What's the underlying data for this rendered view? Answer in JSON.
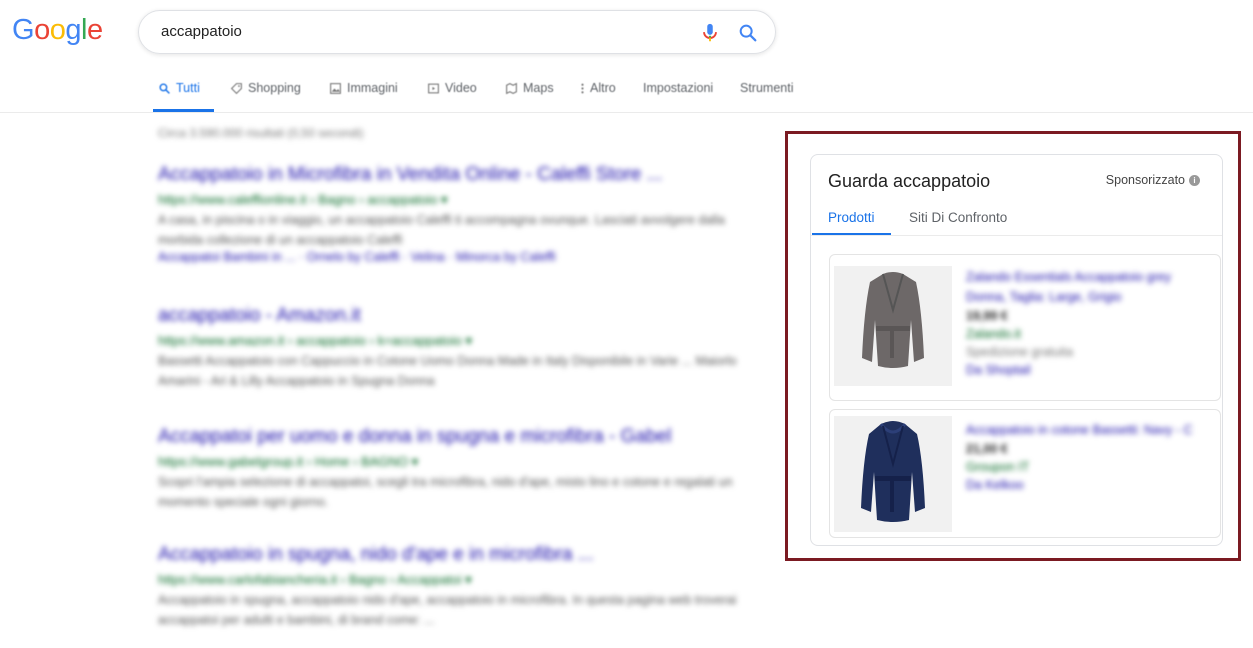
{
  "logo": {
    "text": "Google",
    "letters": [
      "G",
      "o",
      "o",
      "g",
      "l",
      "e"
    ],
    "colors": [
      "#4285f4",
      "#ea4335",
      "#fbbc05",
      "#4285f4",
      "#34a853",
      "#ea4335"
    ]
  },
  "search": {
    "query": "accappatoio",
    "mic_icon": "mic-icon",
    "search_icon": "search-icon"
  },
  "tabs": [
    {
      "label": "Tutti",
      "icon": "search-icon",
      "active": true
    },
    {
      "label": "Shopping",
      "icon": "tag-icon"
    },
    {
      "label": "Immagini",
      "icon": "image-icon"
    },
    {
      "label": "Video",
      "icon": "video-icon"
    },
    {
      "label": "Maps",
      "icon": "map-icon"
    },
    {
      "label": "Altro",
      "icon": "more-icon"
    },
    {
      "label": "Impostazioni"
    },
    {
      "label": "Strumenti"
    }
  ],
  "stats": "Circa 3.590.000 risultati (0,50 secondi)",
  "results": [
    {
      "title": "Accappatoio in Microfibra in Vendita Online - Caleffi Store ...",
      "url": "https://www.caleffionline.it › Bagno › accappatoio ▾",
      "snippet": "A casa, in piscina o in viaggio, un accappatoio Caleffi ti accompagna ovunque. Lasciati avvolgere dalla morbida collezione di un accappatoio Caleffi",
      "links": "Accappatoi Bambini in ... · Ornelo by Caleffi · Velina · Minorca by Caleffi"
    },
    {
      "title": "accappatoio - Amazon.it",
      "url": "https://www.amazon.it › accappatoio › k=accappatoio ▾",
      "snippet": "Bassetti Accappatoio con Cappuccio in Cotone Uomo Donna Made in Italy Disponibile in Varie ... Maiorlo Amarini - Ari & Lilly Accappatoio in Spugna Donna"
    },
    {
      "title": "Accappatoi per uomo e donna in spugna e microfibra - Gabel",
      "url": "https://www.gabelgroup.it › Home › BAGNO ▾",
      "snippet": "Scopri l'ampia selezione di accappatoi, scegli tra microfibra, nido d'ape, misto lino e cotone e regalati un momento speciale ogni giorno."
    },
    {
      "title": "Accappatoio in spugna, nido d'ape e in microfibra ...",
      "url": "https://www.carlofabiancheria.it › Bagno › Accappatoi ▾",
      "snippet": "Accappatoio in spugna, accappatoio nido d'ape, accappatoio in microfibra. In questa pagina web troverai accappatoi per adulti e bambini, di brand come: ..."
    }
  ],
  "panel": {
    "title": "Guarda accappatoio",
    "sponsored": "Sponsorizzato",
    "info_icon": "info-icon",
    "tabs": [
      "Prodotti",
      "Siti Di Confronto"
    ],
    "products": [
      {
        "title": "Zalando Essentials Accappatoio grey Donna, Taglia: Large, Grigio",
        "price": "19,99 €",
        "store": "Zalando.it",
        "shipping": "Spedizione gratuita",
        "by": "Da Shoptail",
        "image": "grey-bathrobe-image",
        "color": "#6d6868"
      },
      {
        "title": "Accappatoio in cotone Bassetti: Navy - C",
        "price": "21,00 €",
        "store": "Groupon IT",
        "by": "Da Kelkoo",
        "image": "navy-bathrobe-image",
        "color": "#1f2f5c"
      }
    ]
  },
  "highlight_color": "#7b1a22"
}
